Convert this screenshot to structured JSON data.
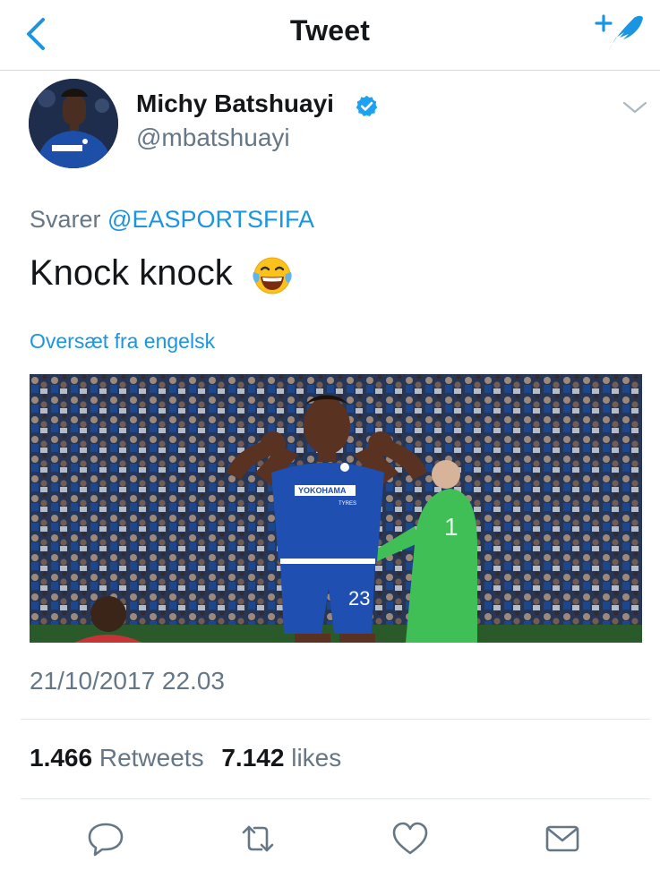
{
  "nav": {
    "title": "Tweet",
    "back_icon": "chevron-left-icon",
    "compose_icon": "compose-feather-icon",
    "accent": "#1b95e0"
  },
  "tweet": {
    "author_name": "Michy Batshuayi",
    "author_handle": "@mbatshuayi",
    "verified": true,
    "reply_prefix": "Svarer",
    "reply_to": "@EASPORTSFIFA",
    "text": "Knock knock",
    "emoji": "face-with-tears-of-joy",
    "translate_label": "Oversæt fra engelsk",
    "timestamp": "21/10/2017 22.03",
    "photo_jersey_sponsor": "YOKOHAMA",
    "photo_jersey_sub": "TYRES",
    "photo_jersey_number": "23"
  },
  "stats": {
    "retweets_count": "1.466",
    "retweets_label": "Retweets",
    "likes_count": "7.142",
    "likes_label": "likes"
  },
  "actions": [
    {
      "name": "reply",
      "icon": "speech-bubble-icon"
    },
    {
      "name": "retweet",
      "icon": "retweet-icon"
    },
    {
      "name": "like",
      "icon": "heart-icon"
    },
    {
      "name": "direct-message",
      "icon": "envelope-icon"
    }
  ],
  "colors": {
    "text_primary": "#14171a",
    "text_secondary": "#657786",
    "link": "#1b95e0",
    "divider": "#e1e8ed",
    "icon_gray": "#657786",
    "verified_blue": "#1da1f2"
  }
}
